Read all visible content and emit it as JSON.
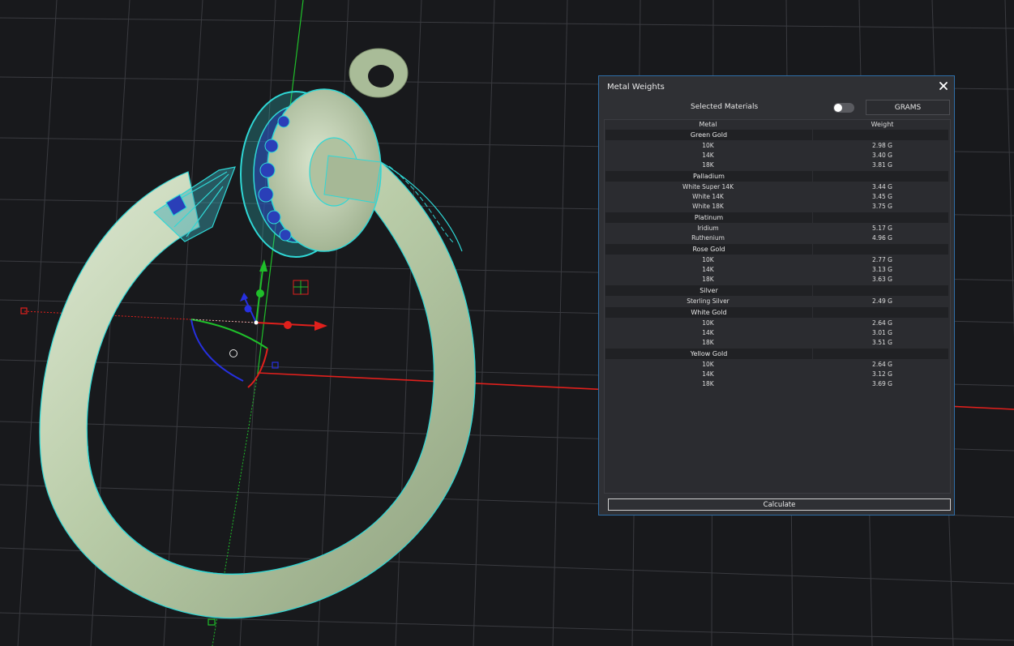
{
  "panel": {
    "title": "Metal Weights",
    "selected_materials_label": "Selected Materials",
    "selected_materials_on": false,
    "unit_button": "GRAMS",
    "columns": [
      "Metal",
      "Weight"
    ],
    "groups": [
      {
        "name": "Green Gold",
        "rows": [
          {
            "metal": "10K",
            "weight": "2.98 G"
          },
          {
            "metal": "14K",
            "weight": "3.40 G"
          },
          {
            "metal": "18K",
            "weight": "3.81 G"
          }
        ]
      },
      {
        "name": "Palladium",
        "rows": [
          {
            "metal": "White Super 14K",
            "weight": "3.44 G"
          },
          {
            "metal": "White 14K",
            "weight": "3.45 G"
          },
          {
            "metal": "White 18K",
            "weight": "3.75 G"
          }
        ]
      },
      {
        "name": "Platinum",
        "rows": [
          {
            "metal": "Iridium",
            "weight": "5.17 G"
          },
          {
            "metal": "Ruthenium",
            "weight": "4.96 G"
          }
        ]
      },
      {
        "name": "Rose Gold",
        "rows": [
          {
            "metal": "10K",
            "weight": "2.77 G"
          },
          {
            "metal": "14K",
            "weight": "3.13 G"
          },
          {
            "metal": "18K",
            "weight": "3.63 G"
          }
        ]
      },
      {
        "name": "Silver",
        "rows": [
          {
            "metal": "Sterling Silver",
            "weight": "2.49 G"
          }
        ]
      },
      {
        "name": "White Gold",
        "rows": [
          {
            "metal": "10K",
            "weight": "2.64 G"
          },
          {
            "metal": "14K",
            "weight": "3.01 G"
          },
          {
            "metal": "18K",
            "weight": "3.51 G"
          }
        ]
      },
      {
        "name": "Yellow Gold",
        "rows": [
          {
            "metal": "10K",
            "weight": "2.64 G"
          },
          {
            "metal": "14K",
            "weight": "3.12 G"
          },
          {
            "metal": "18K",
            "weight": "3.69 G"
          }
        ]
      }
    ],
    "calculate_label": "Calculate"
  },
  "colors": {
    "viewport_bg": "#18191c",
    "grid": "#3a3b40",
    "ring_metal": "#c9d9bd",
    "wireframe": "#2fd8d6",
    "gem": "#2a3fb8",
    "x_axis": "#e0201c",
    "y_axis": "#1fbf2a",
    "z_axis": "#2630e0",
    "panel_bg": "#2f3034",
    "panel_border": "#2e6ea8"
  }
}
